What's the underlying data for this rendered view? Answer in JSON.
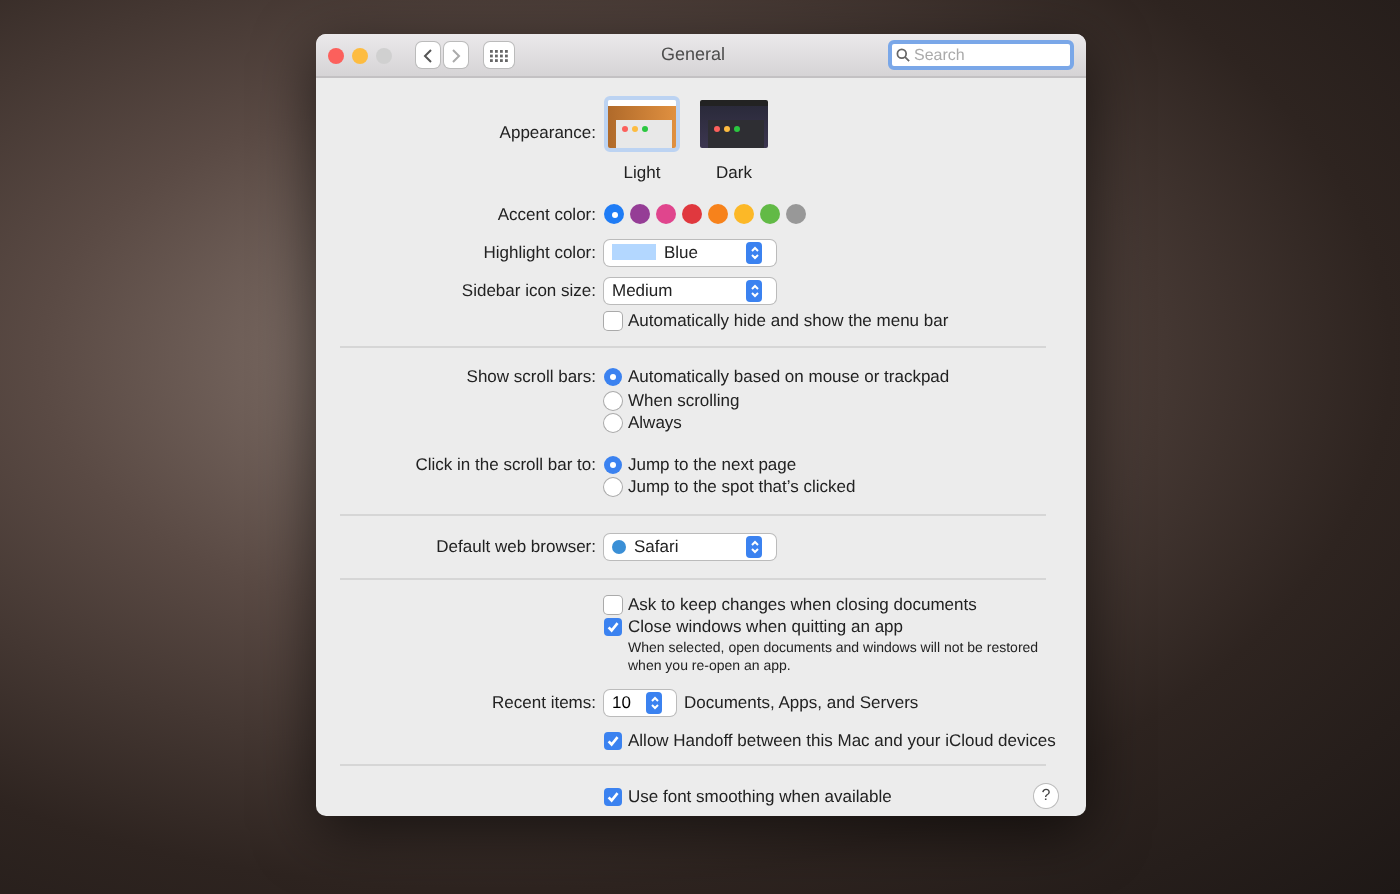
{
  "window": {
    "title": "General",
    "controls": [
      {
        "kind": "close",
        "disabled": false
      },
      {
        "kind": "minimize",
        "disabled": false
      },
      {
        "kind": "zoom",
        "disabled": true
      }
    ]
  },
  "search": {
    "placeholder": "Search"
  },
  "appearance": {
    "label": "Appearance:",
    "options": [
      {
        "label": "Light",
        "kind": "light",
        "selected": true
      },
      {
        "label": "Dark",
        "kind": "dark",
        "selected": false
      }
    ]
  },
  "accent": {
    "label": "Accent color:",
    "colors": [
      {
        "color": "#1f7cf5",
        "selected": true
      },
      {
        "color": "#953d96",
        "selected": false
      },
      {
        "color": "#e0458d",
        "selected": false
      },
      {
        "color": "#e0383e",
        "selected": false
      },
      {
        "color": "#f7821b",
        "selected": false
      },
      {
        "color": "#fcb827",
        "selected": false
      },
      {
        "color": "#62ba46",
        "selected": false
      },
      {
        "color": "#989898",
        "selected": false
      }
    ]
  },
  "highlight": {
    "label": "Highlight color:",
    "value": "Blue",
    "color": "#b3d7ff"
  },
  "sidebar_icon_size": {
    "label": "Sidebar icon size:",
    "value": "Medium"
  },
  "menu_bar": {
    "label": "Automatically hide and show the menu bar",
    "checked": false
  },
  "scroll_bars": {
    "label": "Show scroll bars:",
    "options": [
      {
        "label": "Automatically based on mouse or trackpad",
        "selected": true
      },
      {
        "label": "When scrolling",
        "selected": false
      },
      {
        "label": "Always",
        "selected": false
      }
    ]
  },
  "scroll_click": {
    "label": "Click in the scroll bar to:",
    "options": [
      {
        "label": "Jump to the next page",
        "selected": true
      },
      {
        "label": "Jump to the spot that’s clicked",
        "selected": false
      }
    ]
  },
  "browser": {
    "label": "Default web browser:",
    "value": "Safari"
  },
  "documents": [
    {
      "label": "Ask to keep changes when closing documents",
      "checked": false
    },
    {
      "label": "Close windows when quitting an app",
      "checked": true
    }
  ],
  "documents_note": "When selected, open documents and windows will not be restored when you re-open an app.",
  "recent": {
    "label": "Recent items:",
    "value": "10",
    "suffix": "Documents, Apps, and Servers"
  },
  "handoff": {
    "label": "Allow Handoff between this Mac and your iCloud devices",
    "checked": true
  },
  "font_smoothing": {
    "label": "Use font smoothing when available",
    "checked": true
  },
  "help": "?"
}
